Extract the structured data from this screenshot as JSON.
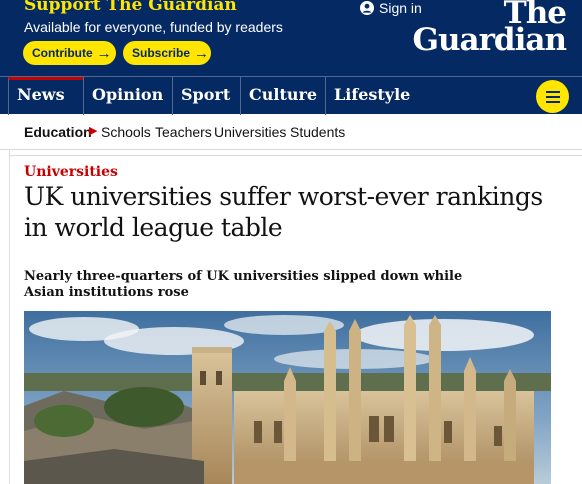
{
  "support": {
    "title": "Support The Guardian",
    "subtitle": "Available for everyone, funded by readers",
    "contribute_label": "Contribute",
    "subscribe_label": "Subscribe",
    "arrow": "→"
  },
  "account": {
    "signin_label": "Sign in"
  },
  "logo": {
    "line1": "The",
    "line2": "Guardian"
  },
  "nav": {
    "items": [
      {
        "label": "News"
      },
      {
        "label": "Opinion"
      },
      {
        "label": "Sport"
      },
      {
        "label": "Culture"
      },
      {
        "label": "Lifestyle"
      }
    ],
    "active": "News"
  },
  "subnav": {
    "section": "Education",
    "separator": "▶",
    "items": [
      {
        "label": "Schools"
      },
      {
        "label": "Teachers"
      },
      {
        "label": "Universities"
      },
      {
        "label": "Students"
      }
    ]
  },
  "article": {
    "kicker": "Universities",
    "headline": "UK universities suffer worst-ever rankings in world league table",
    "standfirst": "Nearly three-quarters of UK universities slipped down while Asian institutions rose"
  },
  "colors": {
    "brand_blue": "#052962",
    "accent_yellow": "#ffe500",
    "news_red": "#c70000"
  },
  "icons": {
    "signin": "user-icon",
    "menu": "hamburger-icon",
    "photo": "oxford-skyline-photo"
  }
}
